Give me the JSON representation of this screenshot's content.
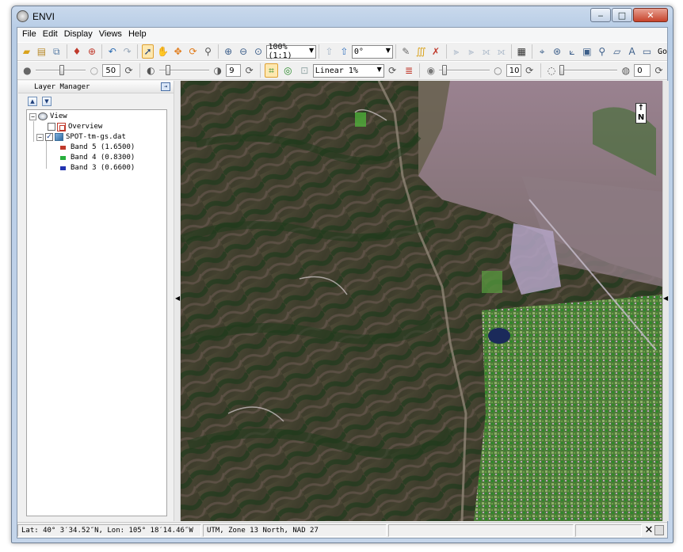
{
  "window": {
    "title": "ENVI",
    "minimize_glyph": "‒",
    "maximize_glyph": "□",
    "close_glyph": "✕"
  },
  "menu": {
    "items": [
      "File",
      "Edit",
      "Display",
      "Views",
      "Help"
    ]
  },
  "toolbar1": {
    "zoom_value": "100% (1:1)",
    "rotation_value": "0°",
    "go_label": "Go"
  },
  "toolbar2": {
    "brightness_value": "50",
    "contrast_value": "9",
    "stretch_value": "Linear 1%",
    "sharpen_value": "10",
    "transparency_value": "0"
  },
  "layer_manager": {
    "title": "Layer Manager",
    "view_label": "View",
    "overview_label": "Overview",
    "raster_label": "SPOT-tm-gs.dat",
    "bands": [
      {
        "label": "Band 5 (1.6500)",
        "color": "#c0392b"
      },
      {
        "label": "Band 4 (0.8300)",
        "color": "#27ae3c"
      },
      {
        "label": "Band 3 (0.6600)",
        "color": "#2233b0"
      }
    ]
  },
  "image": {
    "north_label": "N"
  },
  "status": {
    "latlon": "Lat: 40° 3′34.52″N, Lon: 105° 18′14.46″W",
    "projection": "UTM, Zone 13 North, NAD 27",
    "empty": "",
    "close_glyph": "✕"
  }
}
